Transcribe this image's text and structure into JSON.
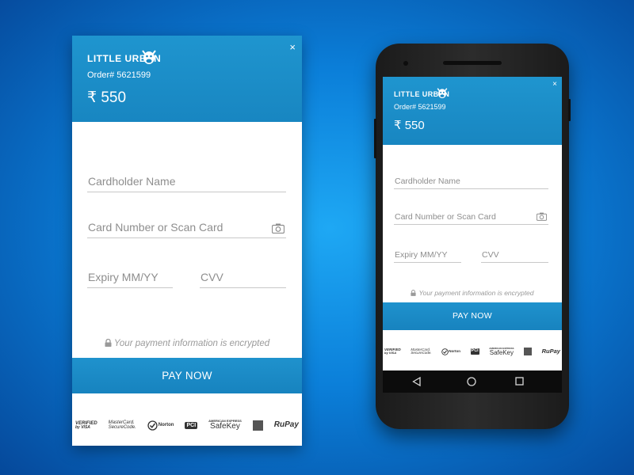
{
  "brand": "LITTLE URBAN",
  "order": "Order# 5621599",
  "amount": "₹ 550",
  "close_label": "×",
  "form": {
    "cardholder_placeholder": "Cardholder Name",
    "card_number_placeholder": "Card Number or Scan Card",
    "expiry_placeholder": "Expiry MM/YY",
    "cvv_placeholder": "CVV"
  },
  "secure_note": "Your payment information is encrypted",
  "pay_label": "PAY NOW",
  "badges": {
    "verified_visa": [
      "VERIFIED",
      "by VISA"
    ],
    "mastercard": [
      "MasterCard.",
      "SecureCode."
    ],
    "norton": "Norton",
    "pci": "PCI",
    "amex": [
      "AMERICAN EXPRESS",
      "SafeKey"
    ],
    "rupay": "RuPay"
  },
  "colors": {
    "background": "#0b7fd9",
    "header": "#1886c1",
    "pay_button": "#1783bf"
  }
}
